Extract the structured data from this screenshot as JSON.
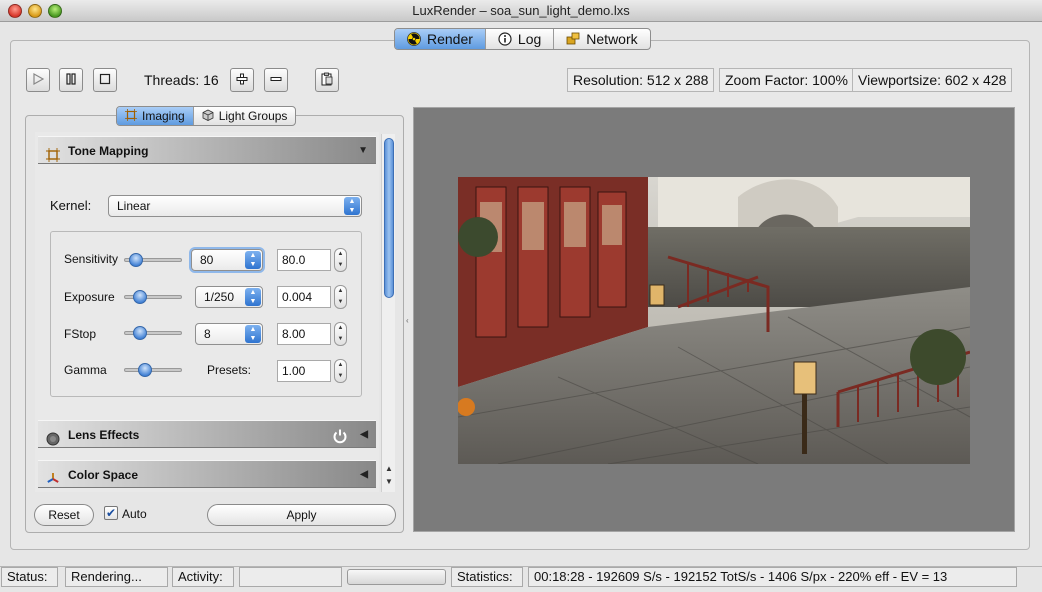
{
  "window": {
    "title": "LuxRender – soa_sun_light_demo.lxs"
  },
  "top_tabs": [
    {
      "label": "Render",
      "icon": "radiation-icon",
      "active": true
    },
    {
      "label": "Log",
      "icon": "info-icon",
      "active": false
    },
    {
      "label": "Network",
      "icon": "network-icon",
      "active": false
    }
  ],
  "toolbar": {
    "threads_label": "Threads: 16"
  },
  "info": {
    "resolution": "Resolution: 512 x 288",
    "zoom": "Zoom Factor: 100%",
    "viewport": "Viewportsize: 602 x 428"
  },
  "sub_tabs": [
    {
      "label": "Imaging",
      "icon": "frame-icon",
      "active": true
    },
    {
      "label": "Light Groups",
      "icon": "lightgroup-icon",
      "active": false
    }
  ],
  "tone_mapping": {
    "header": "Tone Mapping",
    "kernel_label": "Kernel:",
    "kernel_value": "Linear",
    "sensitivity": {
      "label": "Sensitivity",
      "preset": "80",
      "value": "80.0",
      "level": 0.1
    },
    "exposure": {
      "label": "Exposure",
      "preset": "1/250",
      "value": "0.004",
      "level": 0.2
    },
    "fstop": {
      "label": "FStop",
      "preset": "8",
      "value": "8.00",
      "level": 0.2
    },
    "gamma": {
      "label": "Gamma",
      "presets_label": "Presets:",
      "value": "1.00",
      "level": 0.3
    }
  },
  "sections": {
    "lens_effects": "Lens Effects",
    "color_space": "Color Space"
  },
  "panel_buttons": {
    "reset": "Reset",
    "auto": "Auto",
    "apply": "Apply"
  },
  "status": {
    "status_label": "Status:",
    "status_value": "Rendering...",
    "activity_label": "Activity:",
    "activity_value": "",
    "statistics_label": "Statistics:",
    "statistics_value": "00:18:28 - 192609 S/s - 192152 TotS/s - 1406 S/px - 220% eff - EV = 13"
  },
  "colors": {
    "accent": "#5f9be0",
    "viewport_bg": "#7b7b7b"
  }
}
